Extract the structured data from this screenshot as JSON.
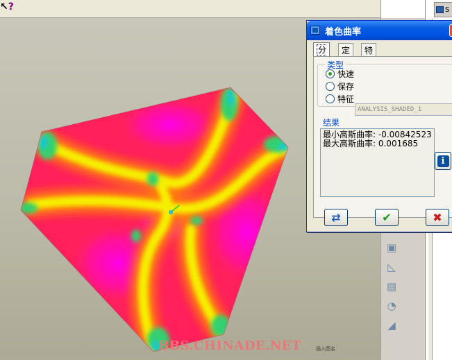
{
  "help_cursor": {
    "glyph": "?"
  },
  "viewport": {
    "watermark": "BBS.CHINADE.NET",
    "corner_label": "插入图名"
  },
  "right_toolbar": {
    "icons": [
      "datum-plane-icon",
      "sketch-icon",
      "extrude-icon",
      "revolve-icon",
      "sweep-icon"
    ]
  },
  "far_right_panel": {
    "header_text": "S"
  },
  "dialog": {
    "title": "着色曲率",
    "tabs": [
      {
        "label": "分析",
        "active": true
      },
      {
        "label": "定义",
        "active": false
      },
      {
        "label": "特征",
        "active": false
      }
    ],
    "type_group": {
      "legend": "类型",
      "options": [
        {
          "label": "快速",
          "checked": true
        },
        {
          "label": "保存",
          "checked": false
        },
        {
          "label": "特征",
          "checked": false
        }
      ],
      "save_name_value": "ANALYSIS_SHADED_1"
    },
    "result_group": {
      "legend": "结果",
      "lines": [
        "最小高斯曲率: -0.00842523",
        "最大高斯曲率: 0.001685"
      ]
    },
    "buttons": {
      "repeat": "repeat-icon",
      "ok": "checkmark-icon",
      "cancel": "close-icon"
    }
  },
  "colors": {
    "titlebar": "#0054e3",
    "surface_base": "#ff1f5a",
    "surface_magenta": "#ff00e0",
    "surface_yellow": "#f5f000",
    "surface_cyan": "#18c8d0",
    "ok_green": "#1a9a1a",
    "cancel_red": "#d01818"
  }
}
